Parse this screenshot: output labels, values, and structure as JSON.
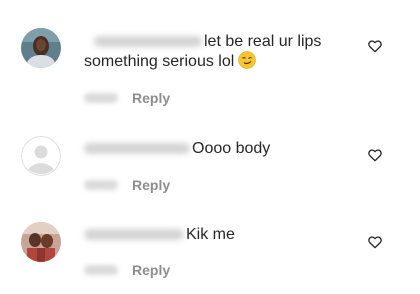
{
  "comments": [
    {
      "text_line1": "let be real ur lips",
      "text_line2": "something serious lol",
      "emoji": "smirk-emoji",
      "reply_label": "Reply"
    },
    {
      "text_line1": "Oooo body",
      "reply_label": "Reply"
    },
    {
      "text_line1": "Kik me",
      "reply_label": "Reply"
    }
  ],
  "icons": {
    "like": "heart-outline-icon"
  },
  "colors": {
    "text": "#262626",
    "secondary": "#8e8e8e",
    "blur": "#d4d4d4"
  }
}
